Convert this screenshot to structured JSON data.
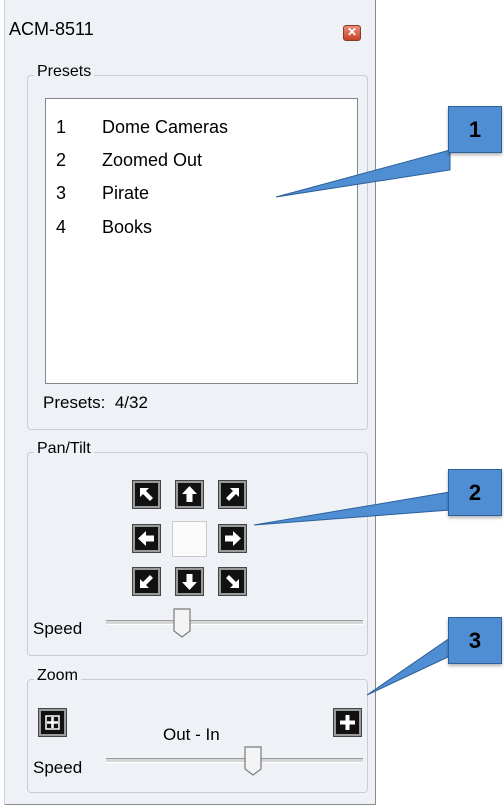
{
  "window": {
    "title": "ACM-8511",
    "close_icon": "close-icon"
  },
  "presets": {
    "legend": "Presets",
    "items": [
      {
        "num": "1",
        "name": "Dome Cameras"
      },
      {
        "num": "2",
        "name": "Zoomed Out"
      },
      {
        "num": "3",
        "name": "Pirate"
      },
      {
        "num": "4",
        "name": "Books"
      }
    ],
    "count_label": "Presets:",
    "count_value": "4/32"
  },
  "pantilt": {
    "legend": "Pan/Tilt",
    "speed_label": "Speed",
    "speed_fraction": 0.42,
    "buttons": [
      "arrow-up-left-icon",
      "arrow-up-icon",
      "arrow-up-right-icon",
      "arrow-left-icon",
      "arrow-right-icon",
      "arrow-down-left-icon",
      "arrow-down-icon",
      "arrow-down-right-icon"
    ]
  },
  "zoom": {
    "legend": "Zoom",
    "direction_label": "Out - In",
    "speed_label": "Speed",
    "speed_fraction": 0.69,
    "out_icon": "zoom-out-icon",
    "in_icon": "plus-icon"
  },
  "callouts": [
    "1",
    "2",
    "3"
  ],
  "colors": {
    "callout": "#4f8ed2",
    "panel": "#eef2f7",
    "close": "#c6432a"
  }
}
